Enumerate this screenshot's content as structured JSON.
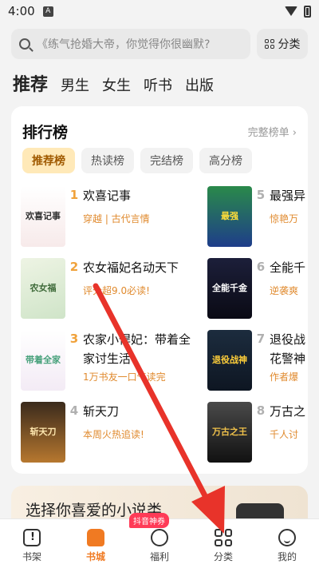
{
  "status": {
    "time": "4:00",
    "notif": "A"
  },
  "search": {
    "placeholder": "《练气抢婚大帝，你觉得你很幽默?",
    "category_label": "分类"
  },
  "top_tabs": [
    "推荐",
    "男生",
    "女生",
    "听书",
    "出版"
  ],
  "ranking": {
    "title": "排行榜",
    "more": "完整榜单 ›",
    "chips": [
      "推荐榜",
      "热读榜",
      "完结榜",
      "高分榜"
    ],
    "left_books": [
      {
        "rank": "1",
        "title": "欢喜记事",
        "tag": "穿越 | 古代言情",
        "cover_text": "欢喜记事"
      },
      {
        "rank": "2",
        "title": "农女福妃名动天下",
        "tag": "评分超9.0必读!",
        "cover_text": "农女福"
      },
      {
        "rank": "3",
        "title": "农家小悍妃：带着全家讨生活",
        "tag": "1万书友一口气读完",
        "cover_text": "带着全家"
      },
      {
        "rank": "4",
        "title": "斩天刀",
        "tag": "本周火热追读!",
        "cover_text": "斩天刀"
      }
    ],
    "right_books": [
      {
        "rank": "5",
        "title": "最强异",
        "tag": "惊艳万",
        "cover_text": "最强"
      },
      {
        "rank": "6",
        "title": "全能千",
        "tag": "逆袭爽",
        "cover_text": "全能千金"
      },
      {
        "rank": "7",
        "title": "退役战花警神",
        "tag": "作者爆",
        "cover_text": "退役战神"
      },
      {
        "rank": "8",
        "title": "万古之",
        "tag": "千人讨",
        "cover_text": "万古之王"
      }
    ]
  },
  "promo": {
    "text": "选择你喜爱的小说类"
  },
  "nav": {
    "items": [
      "书架",
      "书城",
      "福利",
      "分类",
      "我的"
    ],
    "badge": "抖音神券"
  },
  "colors": {
    "accent": "#f07a22",
    "arrow": "#e8332a"
  }
}
